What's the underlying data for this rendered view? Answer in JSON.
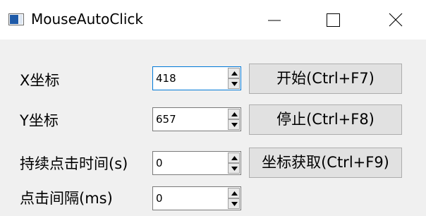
{
  "window": {
    "title": "MouseAutoClick",
    "icon": "app-window-icon",
    "controls": [
      "minimize-icon",
      "maximize-icon",
      "close-icon"
    ]
  },
  "form": {
    "x_label": "X坐标",
    "x_value": "418",
    "y_label": "Y坐标",
    "y_value": "657",
    "duration_label": "持续点击时间(s)",
    "duration_value": "0",
    "interval_label": "点击间隔(ms)",
    "interval_value": "0"
  },
  "buttons": {
    "start": "开始(Ctrl+F7)",
    "stop": "停止(Ctrl+F8)",
    "get_coords": "坐标获取(Ctrl+F9)"
  },
  "colors": {
    "titlebar_bg": "#ffffff",
    "window_bg": "#f0f0f0",
    "focus_border": "#0078d7",
    "button_bg": "#e1e1e1"
  }
}
